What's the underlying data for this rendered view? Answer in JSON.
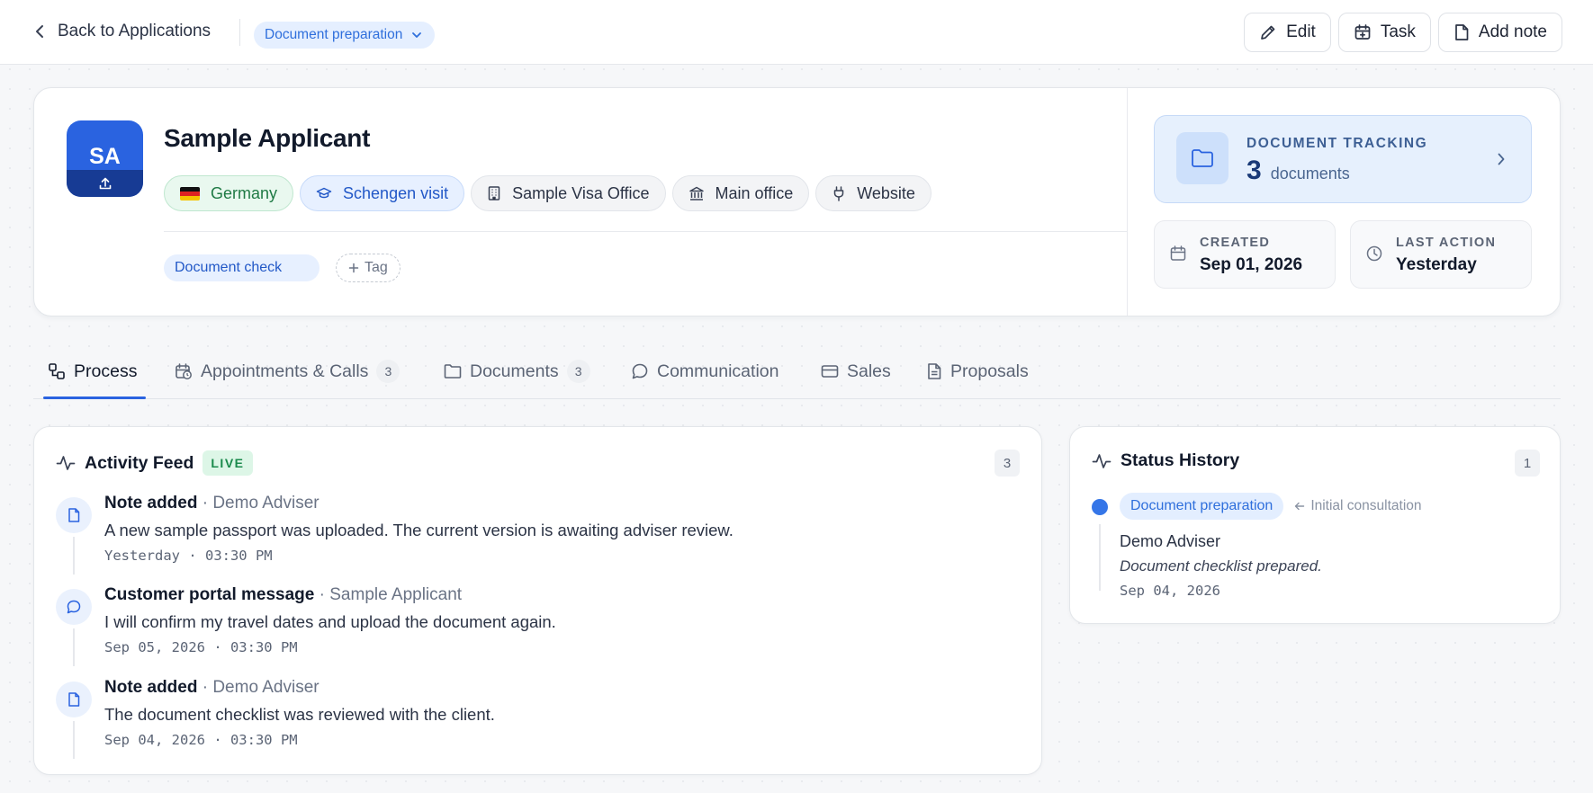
{
  "header": {
    "back_label": "Back to Applications",
    "status": "Document preparation",
    "actions": {
      "edit": "Edit",
      "task": "Task",
      "add_note": "Add note"
    }
  },
  "applicant": {
    "initials": "SA",
    "name": "Sample Applicant",
    "chips": {
      "country": "Germany",
      "visa_type": "Schengen visit",
      "office": "Sample Visa Office",
      "branch": "Main office",
      "source": "Website"
    },
    "tag": "Document check",
    "add_tag_label": "Tag"
  },
  "document_tracking": {
    "label": "DOCUMENT TRACKING",
    "count": "3",
    "unit": "documents"
  },
  "meta": {
    "created_label": "CREATED",
    "created_value": "Sep 01, 2026",
    "last_action_label": "LAST ACTION",
    "last_action_value": "Yesterday"
  },
  "tabs": [
    {
      "label": "Process"
    },
    {
      "label": "Appointments & Calls",
      "badge": "3"
    },
    {
      "label": "Documents",
      "badge": "3"
    },
    {
      "label": "Communication"
    },
    {
      "label": "Sales"
    },
    {
      "label": "Proposals"
    }
  ],
  "activity_feed": {
    "title": "Activity Feed",
    "live_label": "LIVE",
    "count": "3",
    "items": [
      {
        "title": "Note added",
        "author": "· Demo Adviser",
        "body": "A new sample passport was uploaded. The current version is awaiting adviser review.",
        "time": "Yesterday · 03:30 PM"
      },
      {
        "title": "Customer portal message",
        "author": "· Sample Applicant",
        "body": "I will confirm my travel dates and upload the document again.",
        "time": "Sep 05, 2026 · 03:30 PM"
      },
      {
        "title": "Note added",
        "author": "· Demo Adviser",
        "body": "The document checklist was reviewed with the client.",
        "time": "Sep 04, 2026 · 03:30 PM"
      }
    ]
  },
  "status_history": {
    "title": "Status History",
    "count": "1",
    "entry": {
      "status": "Document preparation",
      "previous": "Initial consultation",
      "author": "Demo Adviser",
      "note": "Document checklist prepared.",
      "date": "Sep 04, 2026"
    }
  },
  "colors": {
    "accent": "#2a63e0",
    "live_green": "#1a8a4c",
    "status_blue": "#2f6fdc"
  }
}
